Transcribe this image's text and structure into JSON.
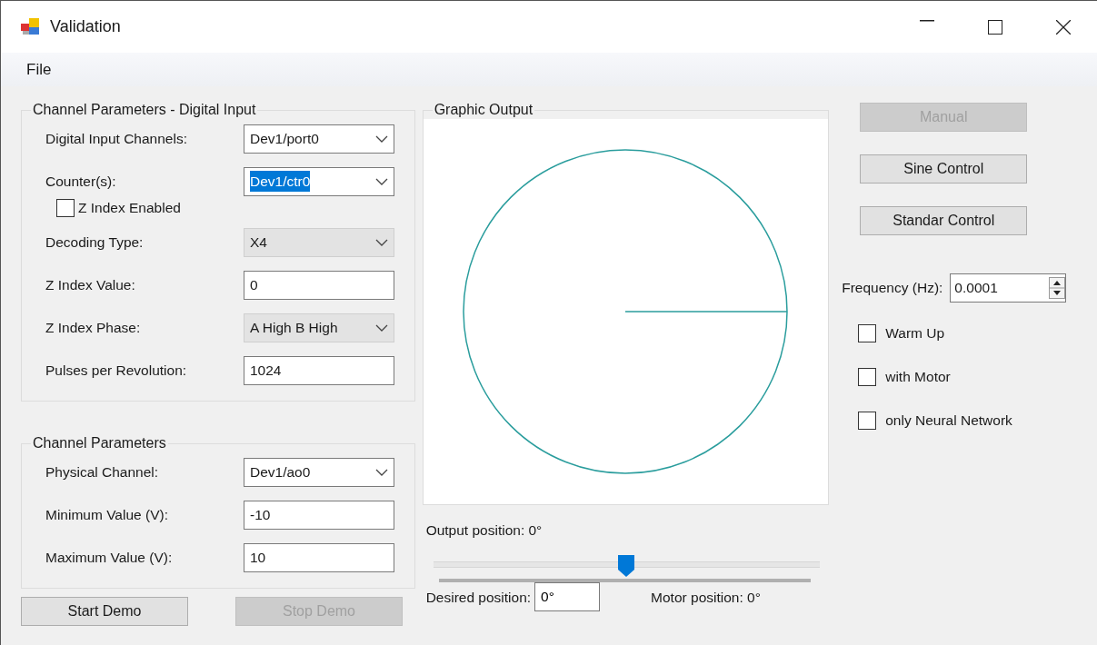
{
  "window": {
    "title": "Validation"
  },
  "menu": [
    {
      "label": "File"
    }
  ],
  "digital_input": {
    "title": "Channel Parameters - Digital Input",
    "fields": [
      {
        "kind": "combo",
        "label": "Digital Input Channels:",
        "value": "Dev1/port0",
        "disabled": false,
        "selected": false
      },
      {
        "kind": "combo",
        "label": "Counter(s):",
        "value": "Dev1/ctr0",
        "disabled": false,
        "selected": true
      },
      {
        "kind": "check",
        "label": "Z Index Enabled",
        "checked": false
      },
      {
        "kind": "combo",
        "label": "Decoding Type:",
        "value": "X4",
        "disabled": true,
        "selected": false
      },
      {
        "kind": "text",
        "label": "Z Index Value:",
        "value": "0"
      },
      {
        "kind": "combo",
        "label": "Z Index Phase:",
        "value": "A High B High",
        "disabled": true,
        "selected": false
      },
      {
        "kind": "text",
        "label": "Pulses per Revolution:",
        "value": "1024"
      }
    ]
  },
  "channel": {
    "title": "Channel Parameters",
    "fields": [
      {
        "kind": "combo",
        "label": "Physical Channel:",
        "value": "Dev1/ao0",
        "disabled": false,
        "selected": false
      },
      {
        "kind": "text",
        "label": "Minimum Value (V):",
        "value": "-10"
      },
      {
        "kind": "text",
        "label": "Maximum Value (V):",
        "value": "10"
      }
    ]
  },
  "demo_buttons": [
    {
      "label": "Start Demo",
      "disabled": false
    },
    {
      "label": "Stop Demo",
      "disabled": true
    }
  ],
  "graphic": {
    "title": "Graphic Output",
    "output_position": "Output position: 0°",
    "slider": {
      "level": 0.5
    },
    "desired_label": "Desired position:",
    "desired_value": "0°",
    "motor_position": "Motor position: 0°"
  },
  "control_buttons": [
    {
      "label": "Manual",
      "disabled": true
    },
    {
      "label": "Sine Control",
      "disabled": false
    },
    {
      "label": "Standar Control",
      "disabled": false
    }
  ],
  "frequency": {
    "label": "Frequency (Hz):",
    "value": "0.0001"
  },
  "options": [
    {
      "label": "Warm Up",
      "checked": false
    },
    {
      "label": "with Motor",
      "checked": false
    },
    {
      "label": "only Neural Network",
      "checked": false
    }
  ]
}
